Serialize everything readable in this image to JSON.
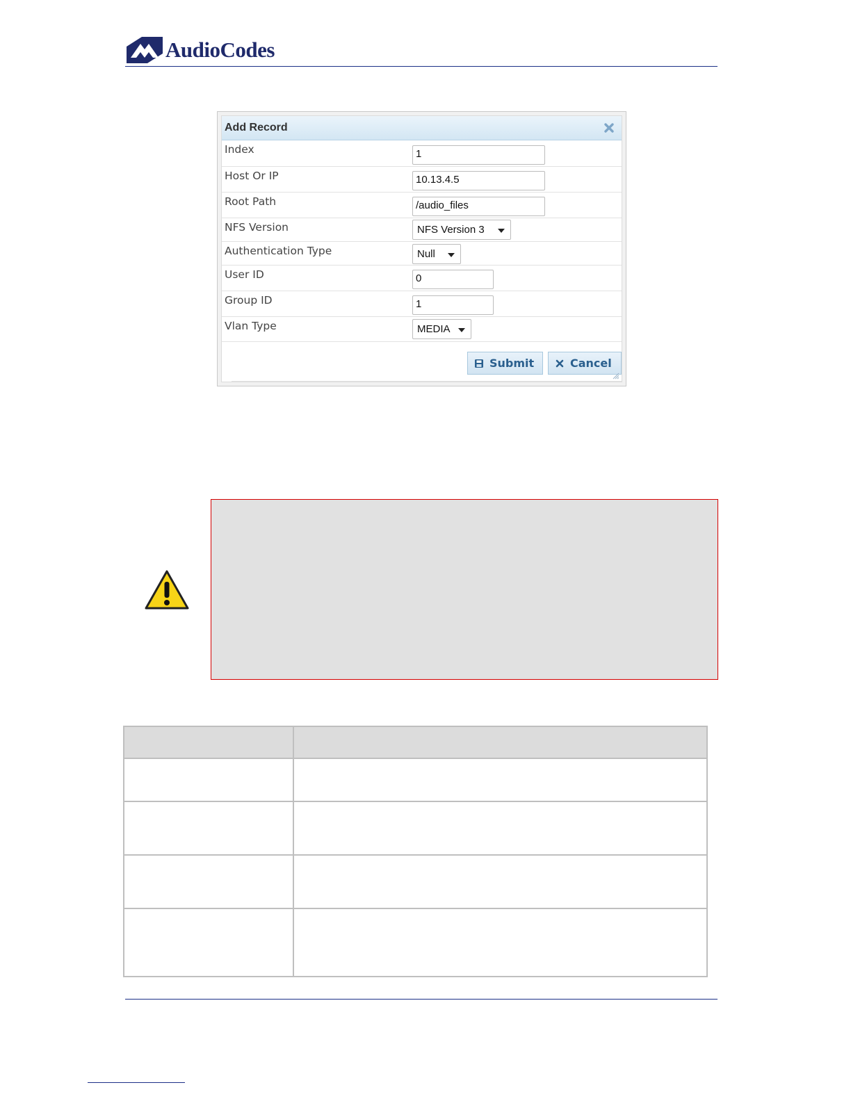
{
  "header": {
    "brand": "AudioCodes"
  },
  "dialog": {
    "title": "Add Record",
    "fields": [
      {
        "label": "Index",
        "value": "1",
        "kind": "text"
      },
      {
        "label": "Host Or IP",
        "value": "10.13.4.5",
        "kind": "text"
      },
      {
        "label": "Root Path",
        "value": "/audio_files",
        "kind": "text"
      },
      {
        "label": "NFS Version",
        "value": "NFS Version 3",
        "kind": "select"
      },
      {
        "label": "Authentication Type",
        "value": "Null",
        "kind": "select"
      },
      {
        "label": "User ID",
        "value": "0",
        "kind": "text"
      },
      {
        "label": "Group ID",
        "value": "1",
        "kind": "text"
      },
      {
        "label": "Vlan Type",
        "value": "MEDIA",
        "kind": "select"
      }
    ],
    "submit_label": "Submit",
    "cancel_label": "Cancel"
  },
  "colors": {
    "rule": "#1b2f86",
    "brand_text": "#1f2a6b",
    "dialog_header": "#d3e6f3",
    "button_text": "#2a5f8e",
    "note_border": "#d40000",
    "note_fill": "#e1e1e1",
    "warning_fill": "#f7d417"
  },
  "icons": {
    "logo": "audiocodes-logo-icon",
    "close": "close-icon",
    "submit": "save-icon",
    "cancel": "cancel-icon",
    "warning": "warning-icon"
  }
}
